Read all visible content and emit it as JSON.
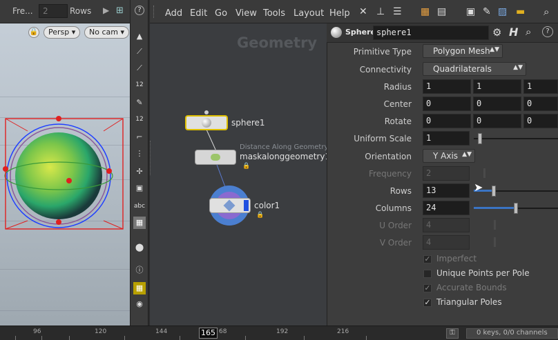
{
  "viewport": {
    "toolbar": {
      "frame_label": "Fre...",
      "frame_value": "2",
      "rows_label": "Rows"
    },
    "persp_label": "Persp",
    "cam_label": "No cam"
  },
  "shelf": {
    "abc_label": "abc",
    "tool_12a": "12",
    "tool_12b": "12"
  },
  "menubar": {
    "items": [
      "Add",
      "Edit",
      "Go",
      "View",
      "Tools",
      "Layout",
      "Help"
    ]
  },
  "network": {
    "title": "Geometry",
    "nodes": [
      {
        "name": "sphere1"
      },
      {
        "name": "maskalonggeometry1",
        "subtitle": "Distance Along Geometry"
      },
      {
        "name": "color1"
      }
    ]
  },
  "params": {
    "node_type": "Sphere",
    "node_name": "sphere1",
    "rows": [
      {
        "label": "Primitive Type",
        "value": "Polygon Mesh"
      },
      {
        "label": "Connectivity",
        "value": "Quadrilaterals"
      },
      {
        "label": "Radius",
        "values": [
          "1",
          "1",
          "1"
        ]
      },
      {
        "label": "Center",
        "values": [
          "0",
          "0",
          "0"
        ]
      },
      {
        "label": "Rotate",
        "values": [
          "0",
          "0",
          "0"
        ]
      },
      {
        "label": "Uniform Scale",
        "value": "1"
      },
      {
        "label": "Orientation",
        "value": "Y Axis"
      },
      {
        "label": "Frequency",
        "value": "2"
      },
      {
        "label": "Rows",
        "value": "13"
      },
      {
        "label": "Columns",
        "value": "24"
      },
      {
        "label": "U Order",
        "value": "4"
      },
      {
        "label": "V Order",
        "value": "4"
      }
    ],
    "slider_levels": {
      "uniform_scale": 0.05,
      "rows": 0.22,
      "columns": 0.5
    },
    "checkboxes": [
      {
        "label": "Imperfect",
        "checked": true,
        "enabled": false
      },
      {
        "label": "Unique Points per Pole",
        "checked": false,
        "enabled": true
      },
      {
        "label": "Accurate Bounds",
        "checked": true,
        "enabled": false
      },
      {
        "label": "Triangular Poles",
        "checked": true,
        "enabled": true
      }
    ]
  },
  "timeline": {
    "ticks": [
      "96",
      "120",
      "144",
      "68",
      "192",
      "216"
    ],
    "current_frame": "165",
    "status": "0 keys, 0/0 channels"
  },
  "colors": {
    "accent": "#3a74c4",
    "selection": "#e0c000"
  }
}
